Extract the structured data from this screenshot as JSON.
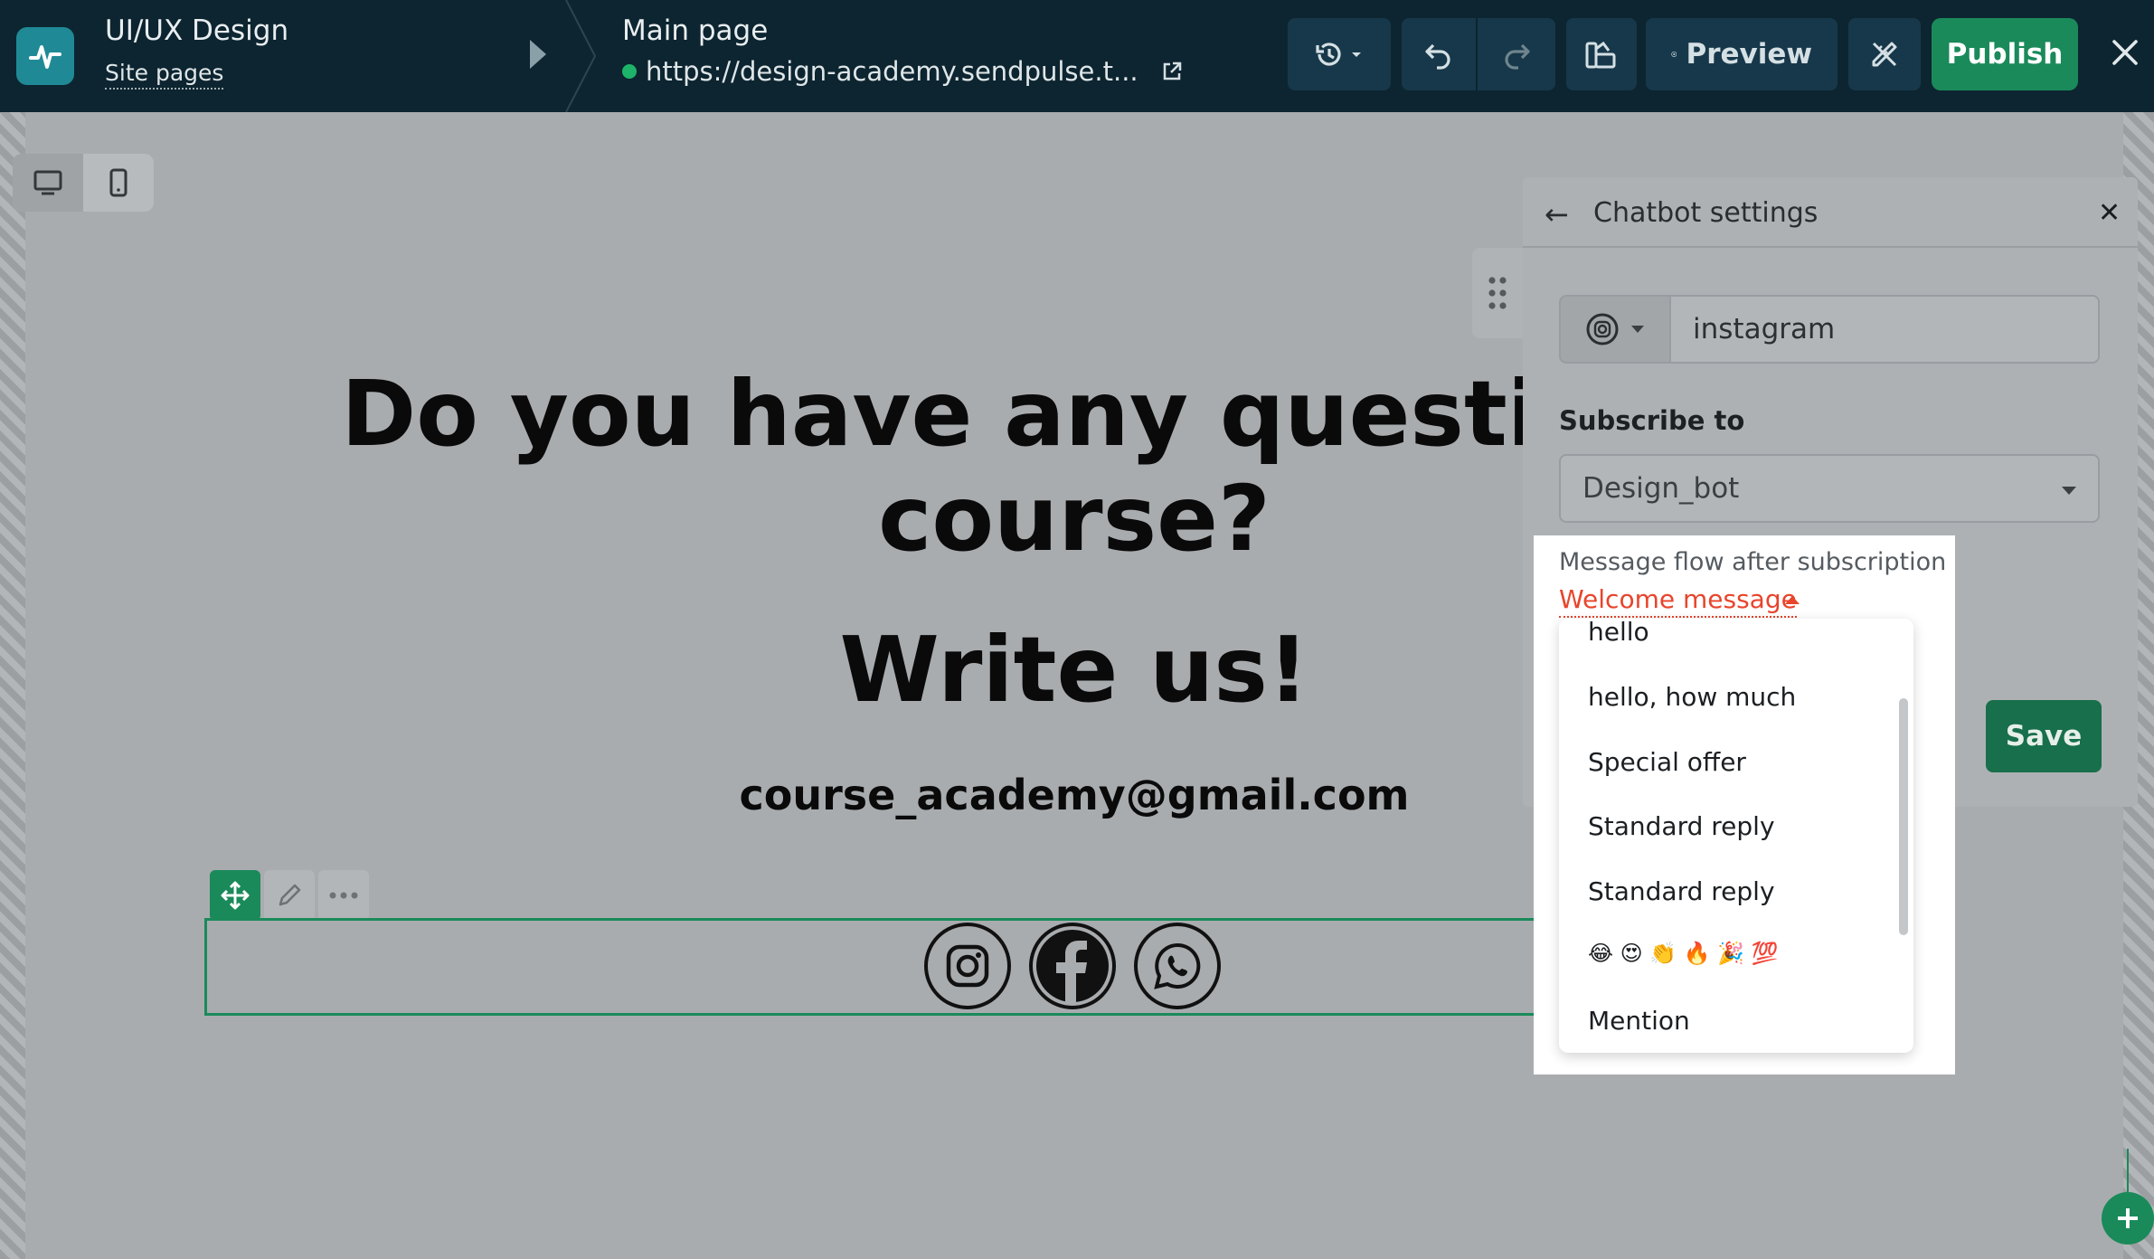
{
  "topbar": {
    "site_title": "UI/UX Design",
    "site_pages_label": "Site pages",
    "page_title": "Main page",
    "page_url": "https://design-academy.sendpulse.t...",
    "preview_label": "Preview",
    "publish_label": "Publish"
  },
  "canvas": {
    "headline_line1": "Do you have any questions a",
    "headline_line2": "course?",
    "write_us": "Write us!",
    "email": "course_academy@gmail.com"
  },
  "panel": {
    "title": "Chatbot settings",
    "channel_value": "instagram",
    "subscribe_label": "Subscribe to",
    "bot_value": "Design_bot",
    "flow_label": "Message flow after subscription",
    "flow_value": "Welcome message",
    "save_label": "Save"
  },
  "dropdown": {
    "items": [
      "hello",
      "hello, how much",
      "Special offer",
      "Standard reply",
      "Standard reply",
      "😂 😍 👏 🔥 🎉 💯",
      "Mention"
    ]
  },
  "colors": {
    "topbar_bg": "#0d2530",
    "accent_green": "#1a8a5a",
    "link_red": "#e8452c"
  }
}
